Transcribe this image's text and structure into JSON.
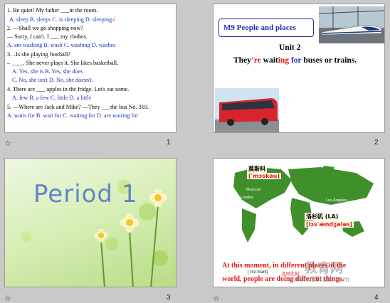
{
  "slides": [
    {
      "number": "1",
      "questions": [
        {
          "q": "1. Be quiet! My father ___in the room.",
          "opts": "A. sleep    B. sleeps    C. is sleeping   D. sleeping"
        },
        {
          "q": "2. —Shall we go shopping now?",
          "opts": ""
        },
        {
          "q": "   — Sorry, I can't. I ___ my clothes.",
          "opts": ""
        },
        {
          "q": "",
          "opts": "A. am washing   B. wash   C. washing   D. washes"
        },
        {
          "q": "3. –Is she playing football?",
          "opts": ""
        },
        {
          "q": "   – ____. She never plays it. She likes basketball.",
          "opts": ""
        },
        {
          "q": "",
          "opts": "A. Yes, she is          B. Yes, she does"
        },
        {
          "q": "",
          "opts": "C. No, she isn't       D.  No, she doesn't."
        },
        {
          "q": "4. There are ___ apples in the fridge. Let's eat some.",
          "opts": ""
        },
        {
          "q": "",
          "opts": "A. few       B. a few       C. little      D. a little"
        },
        {
          "q": "5. —Where are Jack and Mike? —They ___the bus No. 310.",
          "opts": ""
        },
        {
          "q": "",
          "opts": "A. waits for    B. wait for   C. waiting for   D. are waiting for"
        }
      ],
      "star": "☆"
    },
    {
      "number": "2",
      "module_box": "M9  People and places",
      "unit": "Unit 2",
      "sentence_parts": [
        "They",
        "’re",
        " wait",
        "ing",
        " for",
        " buses or trains."
      ]
    },
    {
      "number": "3",
      "title": "Period 1",
      "star": "☆"
    },
    {
      "number": "4",
      "annotation_moscow": "莫斯科",
      "annotation_moscow_ipa": "[ˈmɔskau]",
      "annotation_la": "洛杉矶 (LA)",
      "annotation_la_ipa": "[lɔsˈændʒələs]",
      "labels": {
        "london": "London",
        "moscow": "Moscow",
        "beijing": "Beijing",
        "la": "Los Angeles",
        "ny": "New York"
      },
      "bottom_text_1": "At this moment, in different places of the",
      "bottom_text_2": "world, people are doing different things.",
      "small_ipa": "[ˈmɔːmənt]",
      "small_cn": "此时此刻",
      "watermark_1": "教育网",
      "watermark_2": "www.1Ttsb.com",
      "star": "☆"
    }
  ]
}
